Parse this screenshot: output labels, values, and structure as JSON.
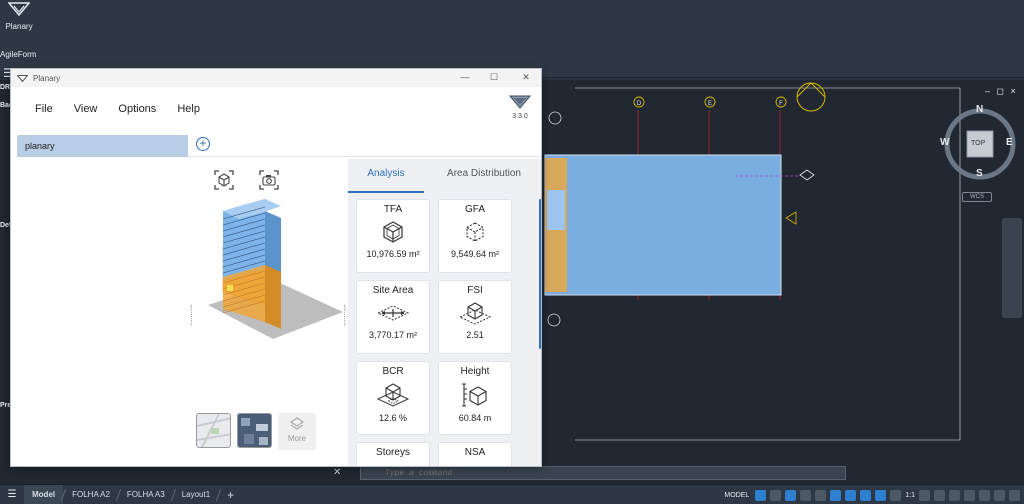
{
  "host": {
    "launcher_label": "Planary",
    "ribbon_label": "AgileForm",
    "command_placeholder": "Type a command",
    "model_mode": "MODEL",
    "scale": "1:1",
    "layout_tabs": [
      "Model",
      "FOLHA A2",
      "FOLHA A3",
      "Layout1"
    ],
    "viewcube": {
      "north": "N",
      "south": "S",
      "east": "E",
      "west": "W",
      "top": "TOP",
      "wcs": "WCS"
    },
    "side_labels": [
      "DR",
      "Bac",
      "Det",
      "Pre"
    ],
    "grid_bubbles": [
      "D",
      "E",
      "F"
    ],
    "colors": {
      "canvas": "#212831",
      "building_fill": "#7aaee0",
      "grid_line": "#c21f1f",
      "bubble": "#d8b800"
    }
  },
  "planary": {
    "window_title": "Planary",
    "menu": [
      "File",
      "View",
      "Options",
      "Help"
    ],
    "version": "3.3.0",
    "projects": [
      {
        "name": "planary"
      }
    ],
    "viewer": {
      "toolbar_icons": [
        "cube-view-icon",
        "camera-icon"
      ],
      "basemaps": [
        "map-thumbnail",
        "satellite-thumbnail"
      ],
      "more_label": "More"
    },
    "analysis": {
      "tabs": [
        "Analysis",
        "Area Distribution"
      ],
      "active_tab": "Analysis",
      "metrics": [
        {
          "label": "TFA",
          "value": "10,976.59 m²",
          "icon": "cube-outline-icon"
        },
        {
          "label": "GFA",
          "value": "9,549.64 m²",
          "icon": "dashed-cube-icon"
        },
        {
          "label": "Site Area",
          "value": "3,770.17 m²",
          "icon": "site-area-icon"
        },
        {
          "label": "FSI",
          "value": "2.51",
          "icon": "fsi-icon"
        },
        {
          "label": "BCR",
          "value": "12.6 %",
          "icon": "bcr-icon"
        },
        {
          "label": "Height",
          "value": "60.84 m",
          "icon": "height-icon"
        },
        {
          "label": "Storeys",
          "value": "",
          "icon": "storeys-icon"
        },
        {
          "label": "NSA",
          "value": "",
          "icon": "nsa-icon"
        }
      ]
    },
    "colors": {
      "accent": "#2f6fb7",
      "project_selected": "#b8cde6",
      "upper_floors": "#7db3e8",
      "lower_floors": "#f0a73a"
    }
  }
}
